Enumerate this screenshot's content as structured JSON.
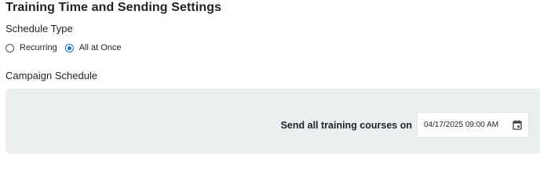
{
  "section": {
    "title": "Training Time and Sending Settings"
  },
  "schedule_type": {
    "label": "Schedule Type",
    "options": [
      {
        "label": "Recurring",
        "selected": false
      },
      {
        "label": "All at Once",
        "selected": true
      }
    ]
  },
  "campaign_schedule": {
    "label": "Campaign Schedule",
    "send_label": "Send all training courses on",
    "date_value": "04/17/2025 09:00 AM",
    "date_icon": "calendar-icon"
  },
  "colors": {
    "accent": "#1a73c8",
    "panel_bg": "#eceff0",
    "text": "#1f2328"
  }
}
